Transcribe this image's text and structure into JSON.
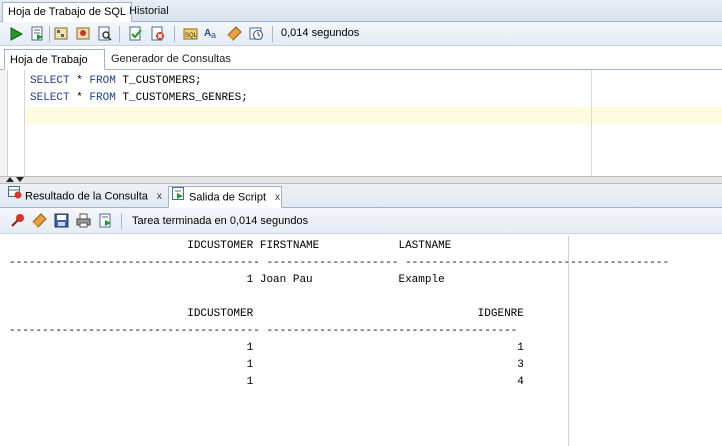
{
  "top_tabs": {
    "active": "Hoja de Trabajo de SQL",
    "inactive": "Historial"
  },
  "toolbar": {
    "timing": "0,014 segundos",
    "icons": [
      "run-statement-icon",
      "run-script-icon",
      "explain-plan-icon",
      "autotrace-icon",
      "sql-tuning-icon",
      "commit-icon",
      "rollback-icon",
      "unshared-sql-icon",
      "to-upper-lower-icon",
      "clear-icon",
      "history-icon"
    ]
  },
  "inner_tabs": {
    "active": "Hoja de Trabajo",
    "inactive": "Generador de Consultas"
  },
  "editor": {
    "lines": [
      {
        "kw1": "SELECT",
        "mid": " * ",
        "kw2": "FROM",
        "rest": " T_CUSTOMERS;"
      },
      {
        "kw1": "SELECT",
        "mid": " * ",
        "kw2": "FROM",
        "rest": " T_CUSTOMERS_GENRES;"
      }
    ]
  },
  "result_tabs": {
    "query_result": "Resultado de la Consulta",
    "script_output": "Salida de Script",
    "close": "x"
  },
  "result_toolbar": {
    "status": "Tarea terminada en 0,014 segundos",
    "icons": [
      "pin-icon",
      "clear-output-icon",
      "save-icon",
      "print-icon",
      "export-icon"
    ]
  },
  "output": {
    "lines": [
      "                           IDCUSTOMER FIRSTNAME            LASTNAME",
      "-------------------------------------- -------------------- ----------------------------------------",
      "",
      "                                    1 Joan Pau             Example",
      "",
      "",
      "                           IDCUSTOMER                                  IDGENRE",
      "-------------------------------------- --------------------------------------",
      "",
      "                                    1                                        1",
      "                                    1                                        3",
      "                                    1                                        4"
    ]
  },
  "colors": {
    "keyword": "#1f3f9a",
    "current_line": "#fdfbe0",
    "tab_border": "#9fb3cc"
  }
}
